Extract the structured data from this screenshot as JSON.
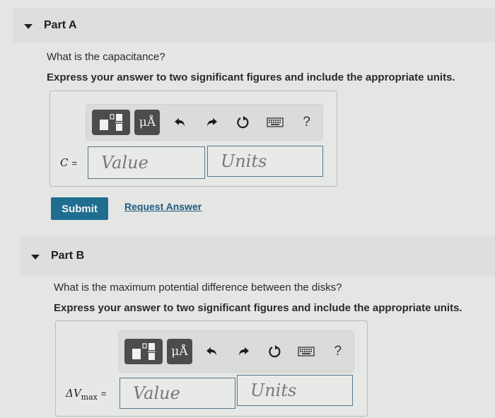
{
  "parts": [
    {
      "title": "Part A",
      "question": "What is the capacitance?",
      "instruction": "Express your answer to two significant figures and include the appropriate units.",
      "variable": "C",
      "subscript": "",
      "equals": "=",
      "value_placeholder": "Value",
      "units_placeholder": "Units",
      "submit_label": "Submit",
      "request_answer_label": "Request Answer"
    },
    {
      "title": "Part B",
      "question": "What is the maximum potential difference between the disks?",
      "instruction": "Express your answer to two significant figures and include the appropriate units.",
      "variable": "ΔV",
      "subscript": "max",
      "equals": "=",
      "value_placeholder": "Value",
      "units_placeholder": "Units"
    }
  ],
  "toolbar": {
    "templates_icon": "templates-icon",
    "units_label": "μÅ",
    "undo_icon": "undo-icon",
    "redo_icon": "redo-icon",
    "reset_icon": "reset-icon",
    "keyboard_icon": "keyboard-icon",
    "help_label": "?"
  },
  "colors": {
    "accent": "#1f6e92",
    "link": "#1f5a80",
    "toolbar_button": "#4d4b4c",
    "input_border": "#55788a"
  }
}
